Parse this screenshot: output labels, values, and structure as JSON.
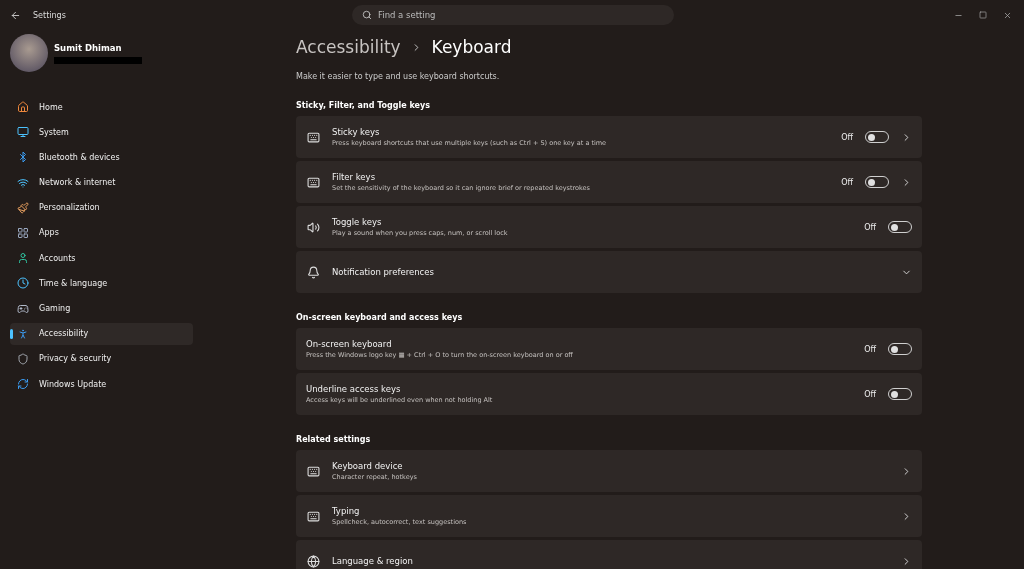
{
  "window": {
    "title": "Settings"
  },
  "search": {
    "placeholder": "Find a setting"
  },
  "user": {
    "name": "Sumit Dhiman"
  },
  "sidebar": {
    "items": [
      {
        "label": "Home",
        "selected": false
      },
      {
        "label": "System",
        "selected": false
      },
      {
        "label": "Bluetooth & devices",
        "selected": false
      },
      {
        "label": "Network & internet",
        "selected": false
      },
      {
        "label": "Personalization",
        "selected": false
      },
      {
        "label": "Apps",
        "selected": false
      },
      {
        "label": "Accounts",
        "selected": false
      },
      {
        "label": "Time & language",
        "selected": false
      },
      {
        "label": "Gaming",
        "selected": false
      },
      {
        "label": "Accessibility",
        "selected": true
      },
      {
        "label": "Privacy & security",
        "selected": false
      },
      {
        "label": "Windows Update",
        "selected": false
      }
    ]
  },
  "breadcrumb": [
    "Accessibility",
    "Keyboard"
  ],
  "description": "Make it easier to type and use keyboard shortcuts.",
  "sections": [
    {
      "title": "Sticky, Filter, and Toggle keys",
      "rows": [
        {
          "kind": "toggle_link",
          "title": "Sticky keys",
          "subtitle": "Press keyboard shortcuts that use multiple keys (such as Ctrl + S) one key at a time",
          "state_label": "Off",
          "on": false
        },
        {
          "kind": "toggle_link",
          "title": "Filter keys",
          "subtitle": "Set the sensitivity of the keyboard so it can ignore brief or repeated keystrokes",
          "state_label": "Off",
          "on": false
        },
        {
          "kind": "toggle",
          "title": "Toggle keys",
          "subtitle": "Play a sound when you press caps, num, or scroll lock",
          "state_label": "Off",
          "on": false
        },
        {
          "kind": "expander",
          "title": "Notification preferences",
          "expanded": false
        }
      ]
    },
    {
      "title": "On-screen keyboard and access keys",
      "rows": [
        {
          "kind": "toggle",
          "title": "On-screen keyboard",
          "subtitle": "Press the Windows logo key ▦ + Ctrl + O to turn the on-screen keyboard on or off",
          "state_label": "Off",
          "on": false
        },
        {
          "kind": "toggle",
          "title": "Underline access keys",
          "subtitle": "Access keys will be underlined even when not holding Alt",
          "state_label": "Off",
          "on": false
        }
      ]
    },
    {
      "title": "Related settings",
      "rows": [
        {
          "kind": "link",
          "title": "Keyboard device",
          "subtitle": "Character repeat, hotkeys"
        },
        {
          "kind": "link",
          "title": "Typing",
          "subtitle": "Spellcheck, autocorrect, text suggestions"
        },
        {
          "kind": "link",
          "title": "Language & region"
        }
      ]
    }
  ]
}
